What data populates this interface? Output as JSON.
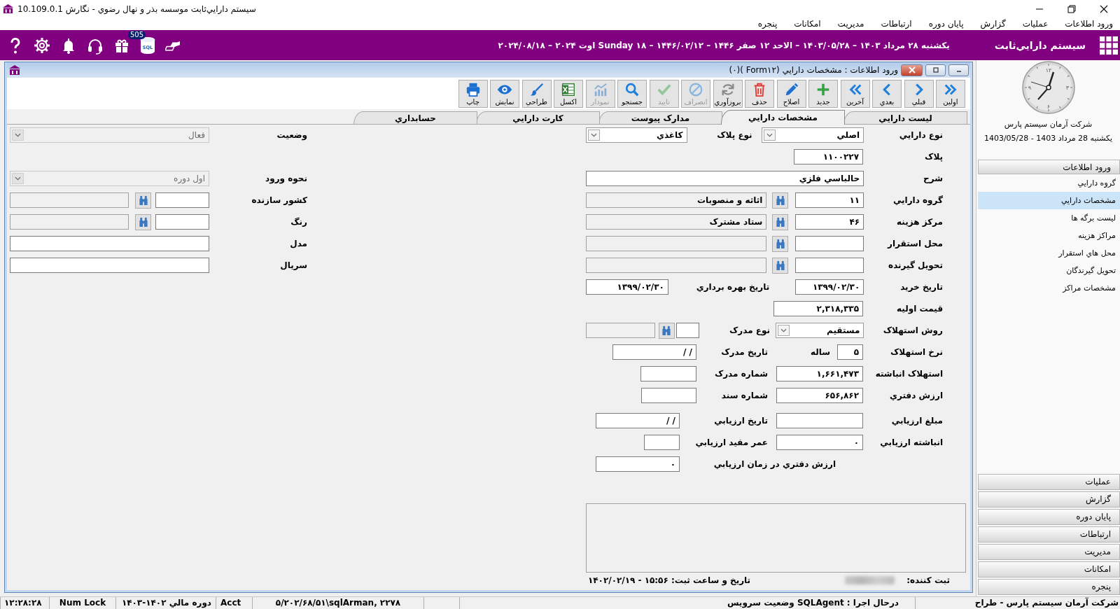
{
  "window": {
    "title": "سيستم دارايي‌ثابت موسسه بذر و نهال رضوي - نگارش 10.109.0.1"
  },
  "menu_bar": [
    "ورود اطلاعات",
    "عمليات",
    "گزارش",
    "پایان دوره",
    "ارتباطات",
    "مديريت",
    "امکانات",
    "پنجره"
  ],
  "header": {
    "title": "سيستم دارايي‌ثابت",
    "date": "يکشنبه ۲۸ مرداد ۱۴۰۳ – ۱۴۰۳/۰۵/۲۸ – الاحد ۱۲ صفر ۱۴۴۶ – ۱۴۴۶/۰۲/۱۲ – ۱۸ Sunday اوت ۲۰۲۴ – ۲۰۲۴/۰۸/۱۸",
    "db_label": "SQL",
    "badge": "505"
  },
  "child_window": {
    "title": "ورود اطلاعات : مشخصات دارايي (Form۱۲ )(۰)",
    "toolbar": [
      {
        "label": "اولين",
        "disabled": false
      },
      {
        "label": "قبلي",
        "disabled": false
      },
      {
        "label": "بعدي",
        "disabled": false
      },
      {
        "label": "آخرين",
        "disabled": false
      },
      {
        "label": "جديد",
        "disabled": false
      },
      {
        "label": "اصلاح",
        "disabled": false
      },
      {
        "label": "حذف",
        "disabled": false
      },
      {
        "label": "بروزآوري",
        "disabled": false
      },
      {
        "label": "انصراف",
        "disabled": true
      },
      {
        "label": "تاييد",
        "disabled": true
      },
      {
        "label": "جستجو",
        "disabled": false
      },
      {
        "label": "نمودار",
        "disabled": true
      },
      {
        "label": "اکسل",
        "disabled": false
      },
      {
        "label": "طراحي",
        "disabled": false
      },
      {
        "label": "نمايش",
        "disabled": false
      },
      {
        "label": "چاپ",
        "disabled": false
      }
    ],
    "tabs": [
      {
        "label": "ليست دارايي",
        "selected": false
      },
      {
        "label": "مشخصات دارايي",
        "selected": true
      },
      {
        "label": "مدارک پيوست",
        "selected": false
      },
      {
        "label": "کارت دارايي",
        "selected": false
      },
      {
        "label": "حسابداري",
        "selected": false
      }
    ],
    "form": {
      "right_rows": [
        [
          {
            "kind": "label",
            "text": "نوع دارايي"
          },
          {
            "kind": "combo",
            "value": "اصلي",
            "disabled": false
          },
          {
            "kind": "label",
            "text": "نوع پلاک"
          },
          {
            "kind": "combo",
            "value": "کاغذي",
            "disabled": false
          }
        ],
        [
          {
            "kind": "label",
            "text": "پلاک"
          },
          {
            "kind": "field",
            "value": "۱۱۰۰۲۲۷"
          }
        ],
        [
          {
            "kind": "label",
            "text": "شرح"
          },
          {
            "kind": "field",
            "value": "حالباسي فلزي"
          }
        ],
        [
          {
            "kind": "label",
            "text": "گروه دارايي"
          },
          {
            "kind": "field",
            "value": "۱۱"
          },
          {
            "kind": "lookup"
          },
          {
            "kind": "readonly",
            "value": "اثاثه و منصوبات"
          }
        ],
        [
          {
            "kind": "label",
            "text": "مرکز هزينه"
          },
          {
            "kind": "field",
            "value": "۴۶"
          },
          {
            "kind": "lookup"
          },
          {
            "kind": "readonly",
            "value": "ستاد مشترک"
          }
        ],
        [
          {
            "kind": "label",
            "text": "محل استقرار"
          },
          {
            "kind": "field"
          },
          {
            "kind": "lookup"
          },
          {
            "kind": "readonly"
          }
        ],
        [
          {
            "kind": "label",
            "text": "تحويل گيرنده"
          },
          {
            "kind": "field"
          },
          {
            "kind": "lookup"
          },
          {
            "kind": "readonly"
          }
        ],
        [
          {
            "kind": "label",
            "text": "تاريخ خريد"
          },
          {
            "kind": "field",
            "value": "۱۳۹۹/۰۲/۳۰"
          },
          {
            "kind": "label",
            "text": "تاريخ بهره برداري"
          },
          {
            "kind": "field",
            "value": "۱۳۹۹/۰۲/۳۰"
          }
        ],
        [
          {
            "kind": "label",
            "text": "قيمت اوليه"
          },
          {
            "kind": "field",
            "value": "۲,۳۱۸,۳۳۵"
          }
        ],
        [
          {
            "kind": "label",
            "text": "روش استهلاک"
          },
          {
            "kind": "combo",
            "value": "مستقيم",
            "disabled": false
          },
          {
            "kind": "label",
            "text": "نوع مدرک"
          },
          {
            "kind": "field"
          },
          {
            "kind": "lookup"
          },
          {
            "kind": "readonly"
          }
        ],
        [
          {
            "kind": "label",
            "text": "نرخ استهلاک"
          },
          {
            "kind": "field",
            "value": "۵"
          },
          {
            "kind": "label",
            "text": "ساله"
          },
          {
            "kind": "label",
            "text": "تاريخ مدرک"
          },
          {
            "kind": "field",
            "value": "/ /"
          }
        ],
        [
          {
            "kind": "label",
            "text": "استهلاک انباشته"
          },
          {
            "kind": "field",
            "value": "۱,۶۶۱,۴۷۳"
          },
          {
            "kind": "label",
            "text": "شماره مدرک"
          },
          {
            "kind": "field"
          }
        ],
        [
          {
            "kind": "label",
            "text": "ارزش دفتري"
          },
          {
            "kind": "field",
            "value": "۶۵۶,۸۶۲"
          },
          {
            "kind": "label",
            "text": "شماره سند"
          },
          {
            "kind": "field"
          }
        ],
        [
          {
            "kind": "label",
            "text": "مبلغ ارزيابي"
          },
          {
            "kind": "field"
          },
          {
            "kind": "label",
            "text": "تاريخ ارزيابي"
          },
          {
            "kind": "field",
            "value": "/ /"
          }
        ],
        [
          {
            "kind": "label",
            "text": "انباشته ارزيابي"
          },
          {
            "kind": "field",
            "value": "۰"
          },
          {
            "kind": "label",
            "text": "عمر مفيد ارزيابي"
          },
          {
            "kind": "field"
          }
        ],
        [
          {
            "kind": "label",
            "text": "ارزش دفتري در زمان ارزيابي"
          },
          {
            "kind": "field",
            "value": "۰"
          }
        ]
      ],
      "left_rows": [
        [
          {
            "kind": "label",
            "text": "وضعيت"
          },
          {
            "kind": "combo",
            "value": "فعال",
            "disabled": true
          }
        ],
        [
          {
            "kind": "label",
            "text": "نحوه ورود"
          },
          {
            "kind": "combo",
            "value": "اول دوره",
            "disabled": true
          }
        ],
        [
          {
            "kind": "label",
            "text": "کشور سازنده"
          },
          {
            "kind": "field"
          },
          {
            "kind": "lookup"
          },
          {
            "kind": "readonly"
          }
        ],
        [
          {
            "kind": "label",
            "text": "رنگ"
          },
          {
            "kind": "field"
          },
          {
            "kind": "lookup"
          },
          {
            "kind": "readonly"
          }
        ],
        [
          {
            "kind": "label",
            "text": "مدل"
          },
          {
            "kind": "field"
          }
        ],
        [
          {
            "kind": "label",
            "text": "سريال"
          },
          {
            "kind": "field"
          }
        ]
      ],
      "footer": {
        "registrar_label": "ثبت کننده:",
        "timestamp": "تاريخ و ساعت ثبت: ۱۵:۵۶ - ۱۴۰۲/۰۲/۱۹"
      }
    }
  },
  "sidebar": {
    "clock_numerals": [
      "۱۲",
      "۳",
      "۶",
      "۹"
    ],
    "company": "شرکت آرمان سيستم پارس",
    "date": "يکشنبه 28 مرداد 1403 - 1403/05/28",
    "sections": [
      {
        "label": "ورود اطلاعات",
        "items": [
          {
            "label": "گروه دارايي",
            "selected": false
          },
          {
            "label": "مشخصات دارايي",
            "selected": true
          },
          {
            "label": "ليست برگه ها",
            "selected": false
          },
          {
            "label": "مراکز هزينه",
            "selected": false
          },
          {
            "label": "محل هاي استقرار",
            "selected": false
          },
          {
            "label": "تحويل گيرندگان",
            "selected": false
          },
          {
            "label": "مشخصات مراکز",
            "selected": false
          }
        ]
      },
      {
        "label": "عمليات"
      },
      {
        "label": "گزارش"
      },
      {
        "label": "پایان دوره"
      },
      {
        "label": "ارتباطات"
      },
      {
        "label": "مديريت"
      },
      {
        "label": "امکانات"
      },
      {
        "label": "پنجره"
      }
    ]
  },
  "status_bar": [
    "شرکت آرمان سيستم پارس - طراح",
    "درحال اجرا : SQLAgent وضعيت سرويس",
    "۵/۲۰۲/۶۸/۵۱\\sqlArman, ۲۲۷۸",
    "Acct",
    "دوره مالي ۱۴۰۲-۱۴۰۳",
    "Num Lock",
    "۱۲:۲۸:۲۸"
  ]
}
